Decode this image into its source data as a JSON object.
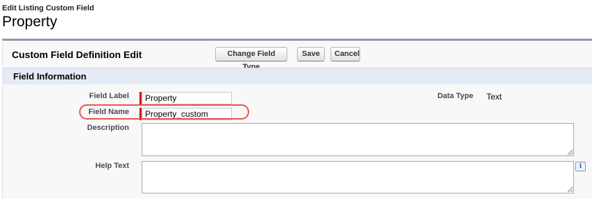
{
  "header": {
    "breadcrumb": "Edit Listing Custom Field",
    "title": "Property"
  },
  "panel": {
    "title": "Custom Field Definition Edit",
    "buttons": {
      "change_field_type": "Change Field Type",
      "save": "Save",
      "cancel": "Cancel"
    }
  },
  "section": {
    "title": "Field Information"
  },
  "fields": {
    "field_label": {
      "label": "Field Label",
      "value": "Property"
    },
    "field_name": {
      "label": "Field Name",
      "value": "Property_custom"
    },
    "description": {
      "label": "Description",
      "value": ""
    },
    "help_text": {
      "label": "Help Text",
      "value": ""
    },
    "data_type": {
      "label": "Data Type",
      "value": "Text"
    }
  },
  "colors": {
    "required_indicator": "#cc0000",
    "annotation_highlight": "#e8534b",
    "section_header_bg": "#e5ebf4"
  },
  "icons": {
    "help_text_info": "info-icon"
  }
}
